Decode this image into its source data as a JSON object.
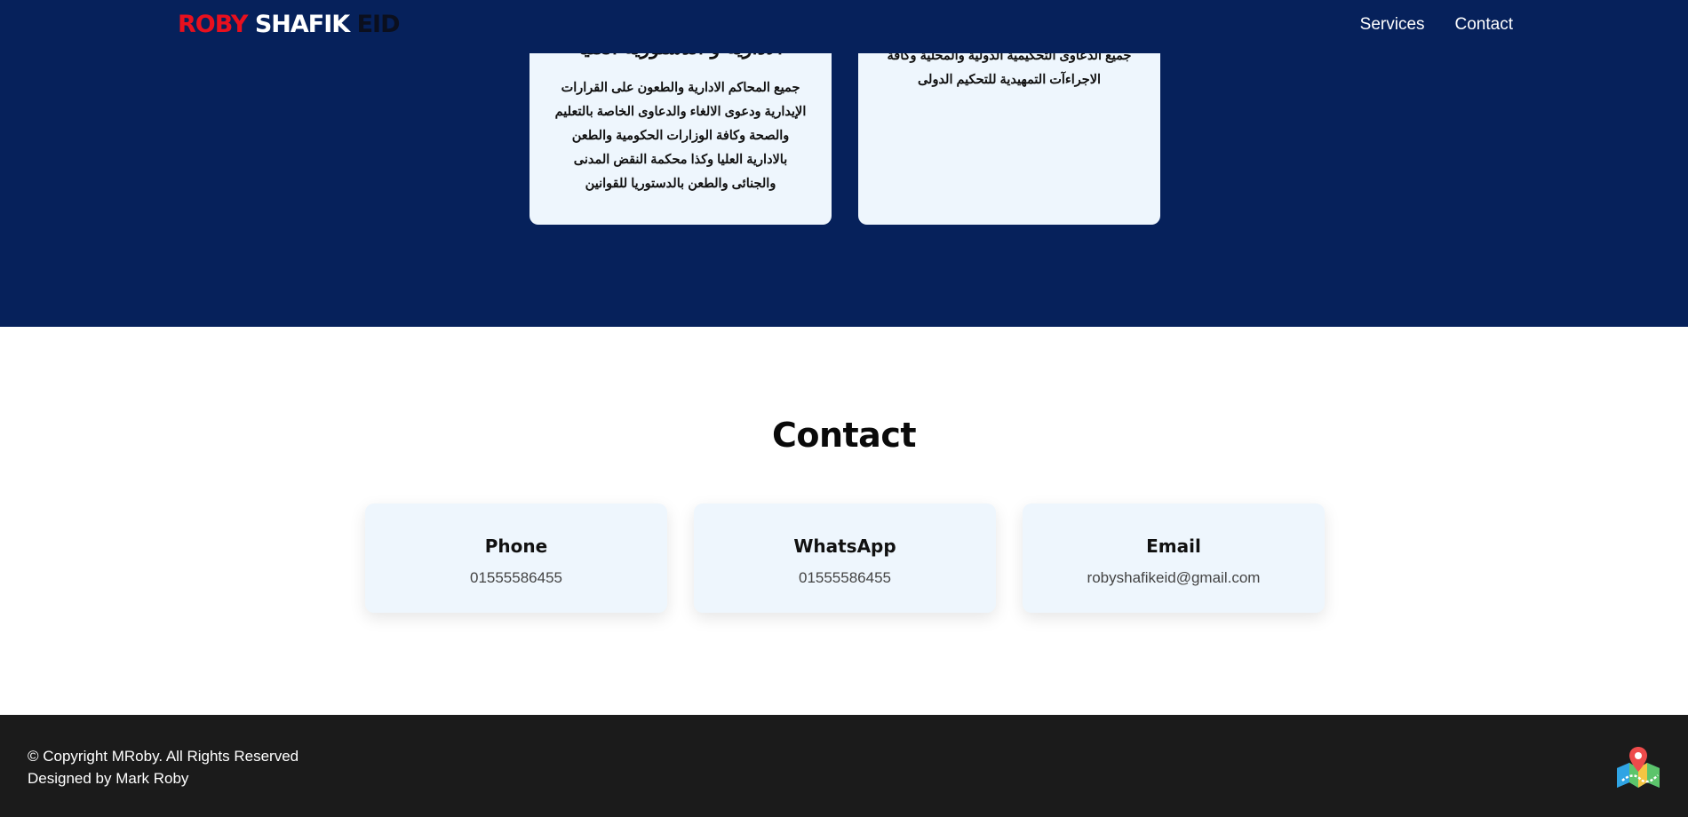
{
  "header": {
    "logo": {
      "part1": "ROBY",
      "part2": "SHAFIK",
      "part3": "EID"
    },
    "nav": [
      {
        "label": "Services"
      },
      {
        "label": "Contact"
      }
    ]
  },
  "services": {
    "cards": [
      {
        "title": "الادارية و الدستورية العليا",
        "text": "جميع المحاكم الادارية والطعون على القرارات الإيدارية ودعوى الالغاء والدعاوى الخاصة بالتعليم والصحة وكافة الوزارات الحكومية والطعن بالادارية العليا وكذا محكمة النقض المدنى والجنائى والطعن بالدستوريا للقوانين"
      },
      {
        "title": "",
        "text": "جميع الدعاوى التحكيمية الدولية والمحلية وكافة الاجراءآت التمهيدية للتحكيم الدولى"
      }
    ]
  },
  "contact": {
    "title": "Contact",
    "cards": [
      {
        "label": "Phone",
        "value": "01555586455"
      },
      {
        "label": "WhatsApp",
        "value": "01555586455"
      },
      {
        "label": "Email",
        "value": "robyshafikeid@gmail.com"
      }
    ]
  },
  "footer": {
    "copyright": "© Copyright MRoby. All Rights Reserved",
    "designer": "Designed by Mark Roby"
  },
  "colors": {
    "navy": "#06215b",
    "brand_red": "#e8101e",
    "card_bg": "#eef6fd",
    "footer_bg": "#1b1b1b"
  },
  "icons": {
    "footer_icon": "map-location-icon"
  }
}
